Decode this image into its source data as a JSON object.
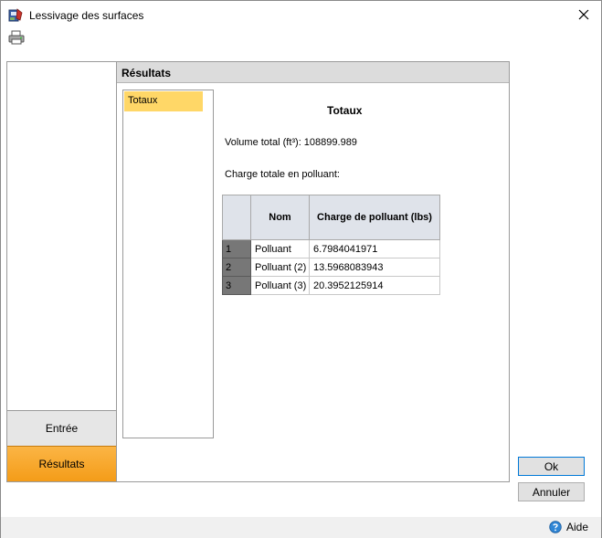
{
  "window": {
    "title": "Lessivage des surfaces",
    "close_glyph": "✕"
  },
  "toolbar": {
    "print_icon": "print-icon"
  },
  "nav": {
    "entree_label": "Entrée",
    "resultats_label": "Résultats"
  },
  "results": {
    "header": "Résultats",
    "list_items": [
      "Totaux"
    ],
    "detail_title": "Totaux",
    "volume_text": "Volume total (ft³): 108899.989",
    "charge_label": "Charge totale en polluant:",
    "table": {
      "columns": [
        "Nom",
        "Charge de polluant (lbs)"
      ],
      "rows": [
        {
          "index": "1",
          "nom": "Polluant",
          "charge": "6.7984041971"
        },
        {
          "index": "2",
          "nom": "Polluant (2)",
          "charge": "13.5968083943"
        },
        {
          "index": "3",
          "nom": "Polluant (3)",
          "charge": "20.3952125914"
        }
      ]
    }
  },
  "buttons": {
    "ok": "Ok",
    "annuler": "Annuler"
  },
  "footer": {
    "help_label": "Aide"
  },
  "colors": {
    "active_nav": "#f49c18",
    "selected_item": "#ffd767",
    "row_header": "#777777"
  }
}
